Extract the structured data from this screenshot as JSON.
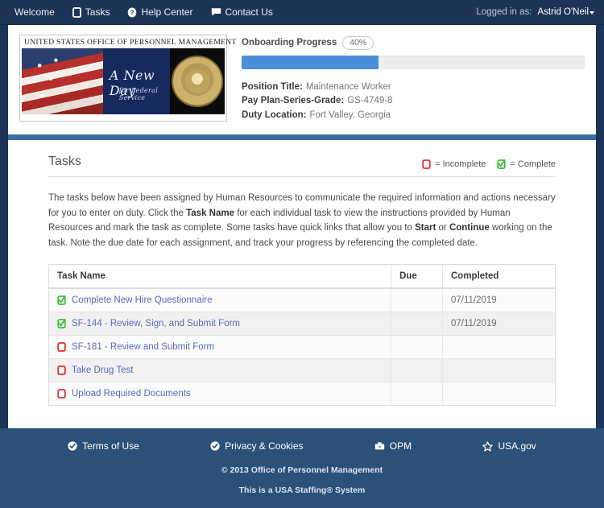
{
  "topbar": {
    "items": [
      {
        "label": "Welcome",
        "icon": "none"
      },
      {
        "label": "Tasks",
        "icon": "tasks-icon"
      },
      {
        "label": "Help Center",
        "icon": "help-circle-icon"
      },
      {
        "label": "Contact Us",
        "icon": "speech-bubble-icon"
      }
    ],
    "logged_in_label": "Logged in as:",
    "user_name": "Astrid O'Neil"
  },
  "banner": {
    "caption": "United States Office of Personnel Management",
    "script_line1": "A New Day",
    "script_line2": "for Federal Service"
  },
  "progress": {
    "title": "Onboarding Progress",
    "percent_label": "40%",
    "percent_value": 40,
    "fill_color": "#4a90d9"
  },
  "position": {
    "rows": [
      {
        "label": "Position Title:",
        "value": "Maintenance Worker"
      },
      {
        "label": "Pay Plan-Series-Grade:",
        "value": "GS-4749-8"
      },
      {
        "label": "Duty Location:",
        "value": "Fort Valley, Georgia"
      }
    ]
  },
  "tasks_section": {
    "title": "Tasks",
    "legend": [
      {
        "label": "= Incomplete",
        "state": "incomplete",
        "color": "#e03030"
      },
      {
        "label": "= Complete",
        "state": "complete",
        "color": "#3dc13d"
      }
    ],
    "intro": {
      "p1": "The tasks below have been assigned by Human Resources to communicate the required information and actions necessary for you to enter on duty. Click the ",
      "b1": "Task Name",
      "p2": " for each individual task to view the instructions provided by Human Resources and mark the task as complete. Some tasks have quick links that allow you to ",
      "b2": "Start",
      "p3": " or ",
      "b3": "Continue",
      "p4": " working on the task. Note the due date for each assignment, and track your progress by referencing the completed date."
    },
    "columns": [
      "Task Name",
      "Due",
      "Completed"
    ],
    "rows": [
      {
        "status": "complete",
        "name": "Complete New Hire Questionnaire",
        "due": "",
        "completed": "07/11/2019"
      },
      {
        "status": "complete",
        "name": "SF-144 - Review, Sign, and Submit Form",
        "due": "",
        "completed": "07/11/2019"
      },
      {
        "status": "incomplete",
        "name": "SF-181 - Review and Submit Form",
        "due": "",
        "completed": ""
      },
      {
        "status": "incomplete",
        "name": "Take Drug Test",
        "due": "",
        "completed": ""
      },
      {
        "status": "incomplete",
        "name": "Upload Required Documents",
        "due": "",
        "completed": ""
      }
    ]
  },
  "footer": {
    "links": [
      {
        "label": "Terms of Use",
        "icon": "check-circle-icon"
      },
      {
        "label": "Privacy & Cookies",
        "icon": "check-circle-icon"
      },
      {
        "label": "OPM",
        "icon": "briefcase-icon"
      },
      {
        "label": "USA.gov",
        "icon": "star-icon"
      }
    ],
    "copyright": "© 2013 Office of Personnel Management",
    "system_note": "This is a USA Staffing® System"
  }
}
